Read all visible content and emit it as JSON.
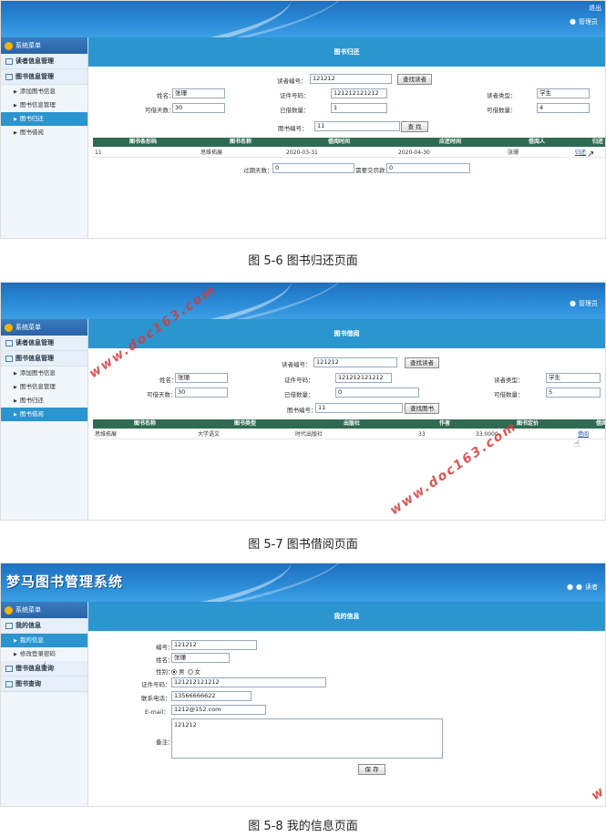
{
  "common": {
    "admin_label": "管理员",
    "reader_label": "读者",
    "sidebar_head": "系统菜单",
    "group_reader": "读者信息管理",
    "group_book": "图书信息管理",
    "item_add": "添加图书信息",
    "item_manage": "图书信息管理",
    "item_return": "图书归还",
    "item_borrow": "图书借阅"
  },
  "shot1": {
    "top_right": "退出",
    "page_title": "图书归还",
    "reader_no_label": "读者编号：",
    "reader_no": "121212",
    "find_reader_btn": "查找读者",
    "name_label": "姓名：",
    "name": "张珊",
    "id_label": "证件号码：",
    "id": "121212121212",
    "type_label": "读者类型：",
    "type": "学生",
    "days_label": "可借天数：",
    "days": "30",
    "borrowed_label": "已借数量：",
    "borrowed": "1",
    "allowed_label": "可借数量：",
    "allowed": "4",
    "book_no_label": "图书编号：",
    "book_no": "11",
    "find_btn": "查 找",
    "columns": [
      "图书条形码",
      "图书名称",
      "借阅时间",
      "应还时间",
      "借阅人",
      "归还"
    ],
    "row": [
      "11",
      "思维拓展",
      "2020-03-31",
      "2020-04-30",
      "张珊",
      "归还"
    ],
    "overdue_label": "过期天数：",
    "overdue": "0",
    "fine_label": "需要交罚款：",
    "fine": "0",
    "caption": "图 5-6 图书归还页面"
  },
  "shot2": {
    "page_title": "图书借阅",
    "reader_no_label": "读者编号：",
    "reader_no": "121212",
    "find_reader_btn": "查找读者",
    "name_label": "姓名：",
    "name": "张珊",
    "id_label": "证件号码：",
    "id": "121212121212",
    "type_label": "读者类型：",
    "type": "学生",
    "days_label": "可借天数：",
    "days": "30",
    "borrowed_label": "已借数量：",
    "borrowed": "0",
    "allowed_label": "可借数量：",
    "allowed": "5",
    "book_no_label": "图书编号：",
    "book_no": "11",
    "find_book_btn": "查找图书",
    "columns": [
      "图书名称",
      "图书类型",
      "出版社",
      "作者",
      "图书定价",
      "借阅"
    ],
    "row": [
      "思维拓展",
      "大学语文",
      "时代出版社",
      "33",
      "33.0000",
      "借阅"
    ],
    "caption": "图 5-7 图书借阅页面"
  },
  "shot3": {
    "app_title": "梦马图书管理系统",
    "group_mine": "我的信息",
    "item_myinfo": "我的信息",
    "item_password": "修改登录密码",
    "group_borrow_query": "借书信息查询",
    "group_book_query": "图书查询",
    "page_title": "我的信息",
    "no_label": "编号：",
    "no": "121212",
    "name_label": "姓名：",
    "name": "张珊",
    "gender_label": "性别：",
    "male": "男",
    "female": "女",
    "id_label": "证件号码：",
    "id": "121212121212",
    "phone_label": "联系电话：",
    "phone": "13566666622",
    "email_label": "E-mail：",
    "email": "1212@152.com",
    "remark_label": "备注：",
    "remark": "121212",
    "save_btn": "保 存",
    "caption": "图 5-8 我的信息页面"
  },
  "watermark": "www.doc163.com"
}
